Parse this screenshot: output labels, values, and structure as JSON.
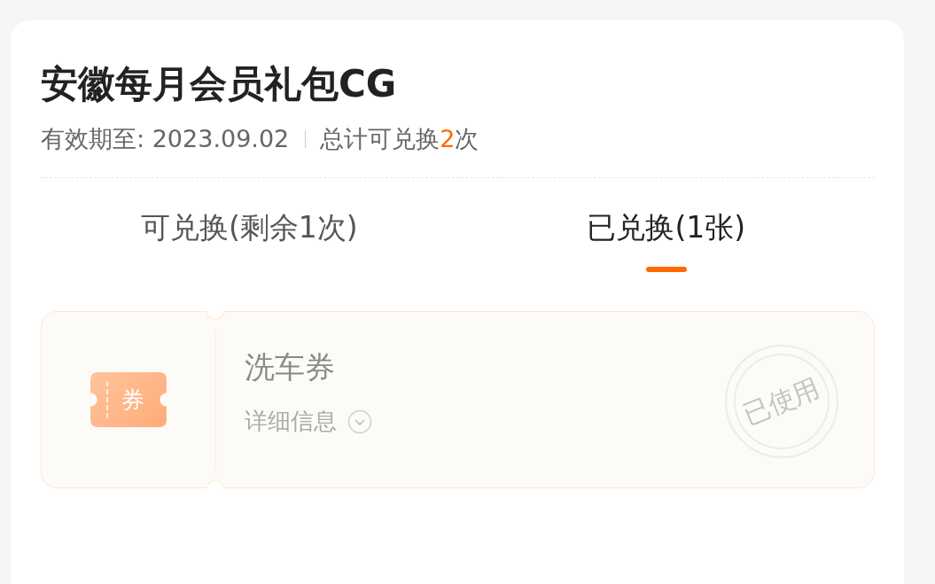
{
  "package": {
    "title": "安徽每月会员礼包CG",
    "validity": "有效期至: 2023.09.02",
    "total_prefix": "总计可兑换",
    "total_count": "2",
    "total_suffix": "次"
  },
  "tabs": [
    {
      "label": "可兑换(剩余1次)",
      "selected": false
    },
    {
      "label": "已兑换(1张)",
      "selected": true
    }
  ],
  "coupons": [
    {
      "badge": "券",
      "name": "洗车券",
      "details_link": "详细信息",
      "used": true,
      "stamp": "已使用"
    }
  ]
}
